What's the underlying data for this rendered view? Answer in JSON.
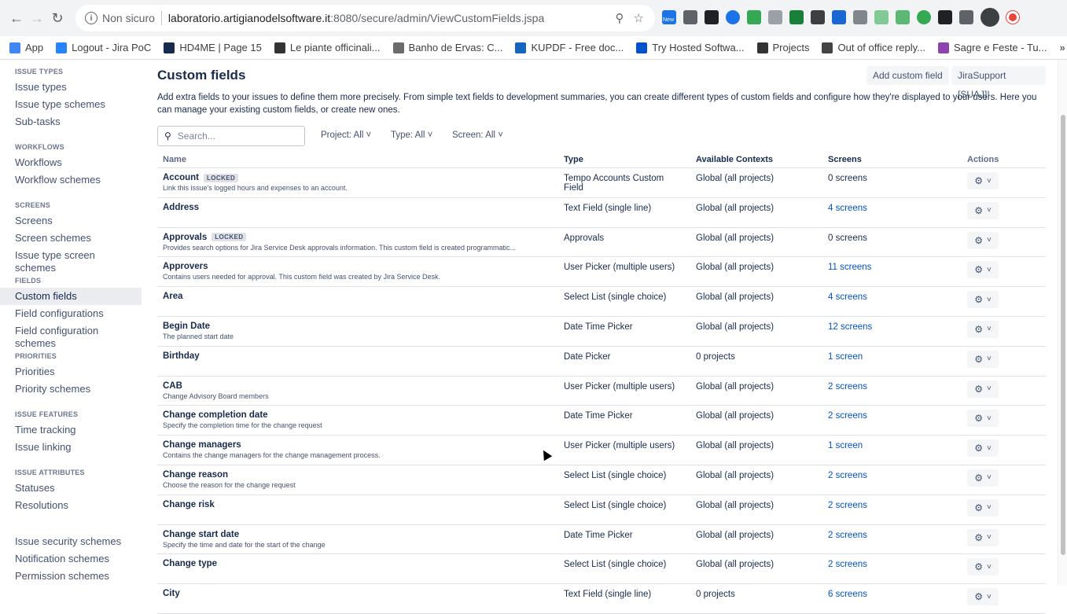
{
  "browser": {
    "insecure_label": "Non sicuro",
    "url_host": "laboratorio.artigianodelsoftware.it",
    "url_rest": ":8080/secure/admin/ViewCustomFields.jspa",
    "bookmarks": [
      {
        "label": "App",
        "color": "#4285f4"
      },
      {
        "label": "Logout - Jira PoC",
        "color": "#2684ff"
      },
      {
        "label": "HD4ME | Page 15",
        "color": "#172b4d"
      },
      {
        "label": "Le piante officinali...",
        "color": "#333333"
      },
      {
        "label": "Banho de Ervas: C...",
        "color": "#6b6b6b"
      },
      {
        "label": "KUPDF - Free doc...",
        "color": "#1565c0"
      },
      {
        "label": "Try Hosted Softwa...",
        "color": "#0052cc"
      },
      {
        "label": "Projects",
        "color": "#333333"
      },
      {
        "label": "Out of office reply...",
        "color": "#444444"
      },
      {
        "label": "Sagre e Feste - Tu...",
        "color": "#8e44ad"
      }
    ],
    "extension_new": "New"
  },
  "sidebar": {
    "groups": [
      {
        "heading": "ISSUE TYPES",
        "items": [
          "Issue types",
          "Issue type schemes",
          "Sub-tasks"
        ]
      },
      {
        "heading": "WORKFLOWS",
        "items": [
          "Workflows",
          "Workflow schemes"
        ]
      },
      {
        "heading": "SCREENS",
        "items": [
          "Screens",
          "Screen schemes",
          "Issue type screen schemes"
        ]
      },
      {
        "heading": "FIELDS",
        "items": [
          "Custom fields",
          "Field configurations",
          "Field configuration schemes"
        ]
      },
      {
        "heading": "PRIORITIES",
        "items": [
          "Priorities",
          "Priority schemes"
        ]
      },
      {
        "heading": "ISSUE FEATURES",
        "items": [
          "Time tracking",
          "Issue linking"
        ]
      },
      {
        "heading": "ISSUE ATTRIBUTES",
        "items": [
          "Statuses",
          "Resolutions"
        ]
      },
      {
        "heading": "",
        "items": [
          "Issue security schemes",
          "Notification schemes",
          "Permission schemes"
        ]
      }
    ],
    "active_item": "Custom fields"
  },
  "main": {
    "title": "Custom fields",
    "add_button": "Add custom field",
    "support_button": "JiraSupport [SUAJ]!",
    "description": "Add extra fields to your issues to define them more precisely. From simple text fields to development summaries, you can create different types of custom fields and configure how they're displayed to your users. Here you can manage your existing custom fields, or create new ones.",
    "search_placeholder": "Search...",
    "filters": {
      "project": "Project: All",
      "type": "Type: All",
      "screen": "Screen: All"
    },
    "columns": {
      "name": "Name",
      "type": "Type",
      "contexts": "Available Contexts",
      "screens": "Screens",
      "actions": "Actions"
    },
    "rows": [
      {
        "name": "Account",
        "locked": "LOCKED",
        "desc": "Link this issue's logged hours and expenses to an account.",
        "type": "Tempo Accounts Custom Field",
        "contexts": "Global (all projects)",
        "screens": "0 screens",
        "screens_link": false
      },
      {
        "name": "Address",
        "locked": "",
        "desc": "",
        "type": "Text Field (single line)",
        "contexts": "Global (all projects)",
        "screens": "4 screens",
        "screens_link": true
      },
      {
        "name": "Approvals",
        "locked": "LOCKED",
        "desc": "Provides search options for Jira Service Desk approvals information. This custom field is created programmatic...",
        "type": "Approvals",
        "contexts": "Global (all projects)",
        "screens": "0 screens",
        "screens_link": false
      },
      {
        "name": "Approvers",
        "locked": "",
        "desc": "Contains users needed for approval. This custom field was created by Jira Service Desk.",
        "type": "User Picker (multiple users)",
        "contexts": "Global (all projects)",
        "screens": "11 screens",
        "screens_link": true
      },
      {
        "name": "Area",
        "locked": "",
        "desc": "",
        "type": "Select List (single choice)",
        "contexts": "Global (all projects)",
        "screens": "4 screens",
        "screens_link": true
      },
      {
        "name": "Begin Date",
        "locked": "",
        "desc": "The planned start date",
        "type": "Date Time Picker",
        "contexts": "Global (all projects)",
        "screens": "12 screens",
        "screens_link": true
      },
      {
        "name": "Birthday",
        "locked": "",
        "desc": "",
        "type": "Date Picker",
        "contexts": "0 projects",
        "screens": "1 screen",
        "screens_link": true
      },
      {
        "name": "CAB",
        "locked": "",
        "desc": "Change Advisory Board members",
        "type": "User Picker (multiple users)",
        "contexts": "Global (all projects)",
        "screens": "2 screens",
        "screens_link": true
      },
      {
        "name": "Change completion date",
        "locked": "",
        "desc": "Specify the completion time for the change request",
        "type": "Date Time Picker",
        "contexts": "Global (all projects)",
        "screens": "2 screens",
        "screens_link": true
      },
      {
        "name": "Change managers",
        "locked": "",
        "desc": "Contains the change managers for the change management process.",
        "type": "User Picker (multiple users)",
        "contexts": "Global (all projects)",
        "screens": "1 screen",
        "screens_link": true
      },
      {
        "name": "Change reason",
        "locked": "",
        "desc": "Choose the reason for the change request",
        "type": "Select List (single choice)",
        "contexts": "Global (all projects)",
        "screens": "2 screens",
        "screens_link": true
      },
      {
        "name": "Change risk",
        "locked": "",
        "desc": "",
        "type": "Select List (single choice)",
        "contexts": "Global (all projects)",
        "screens": "2 screens",
        "screens_link": true
      },
      {
        "name": "Change start date",
        "locked": "",
        "desc": "Specify the time and date for the start of the change",
        "type": "Date Time Picker",
        "contexts": "Global (all projects)",
        "screens": "2 screens",
        "screens_link": true
      },
      {
        "name": "Change type",
        "locked": "",
        "desc": "",
        "type": "Select List (single choice)",
        "contexts": "Global (all projects)",
        "screens": "2 screens",
        "screens_link": true
      },
      {
        "name": "City",
        "locked": "",
        "desc": "",
        "type": "Text Field (single line)",
        "contexts": "0 projects",
        "screens": "6 screens",
        "screens_link": true
      }
    ]
  }
}
